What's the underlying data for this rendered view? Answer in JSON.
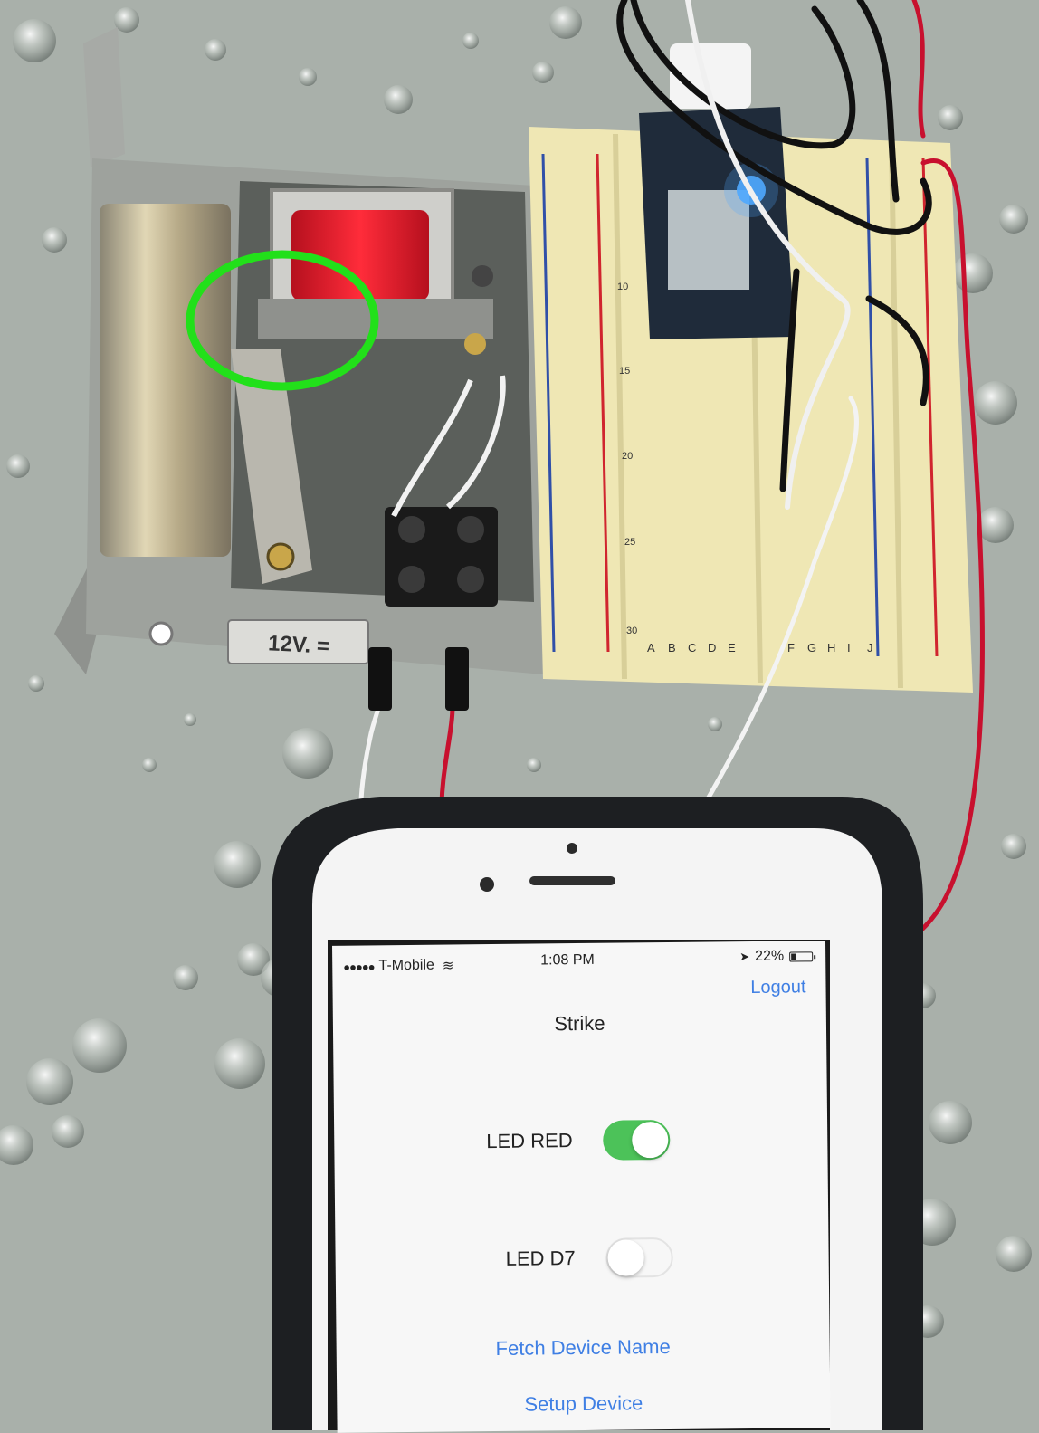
{
  "strike": {
    "voltage_label": "12V. ="
  },
  "breadboard": {
    "row_numbers": [
      "10",
      "15",
      "20",
      "25",
      "30"
    ],
    "column_letters_left": [
      "A",
      "B",
      "C",
      "D",
      "E"
    ],
    "column_letters_right": [
      "F",
      "G",
      "H",
      "I",
      "J"
    ]
  },
  "phone": {
    "status_bar": {
      "carrier": "T-Mobile",
      "time": "1:08 PM",
      "battery": "22%"
    },
    "logout_label": "Logout",
    "title": "Strike",
    "toggles": [
      {
        "label": "LED RED",
        "on": true
      },
      {
        "label": "LED D7",
        "on": false
      }
    ],
    "links": {
      "fetch": "Fetch Device Name",
      "setup": "Setup Device"
    }
  },
  "colors": {
    "toggle_on": "#4cc259",
    "link_blue": "#3f7fe4",
    "highlight_circle": "#22e01a",
    "coil_red": "#e3232e",
    "wire_red": "#c8102e"
  }
}
